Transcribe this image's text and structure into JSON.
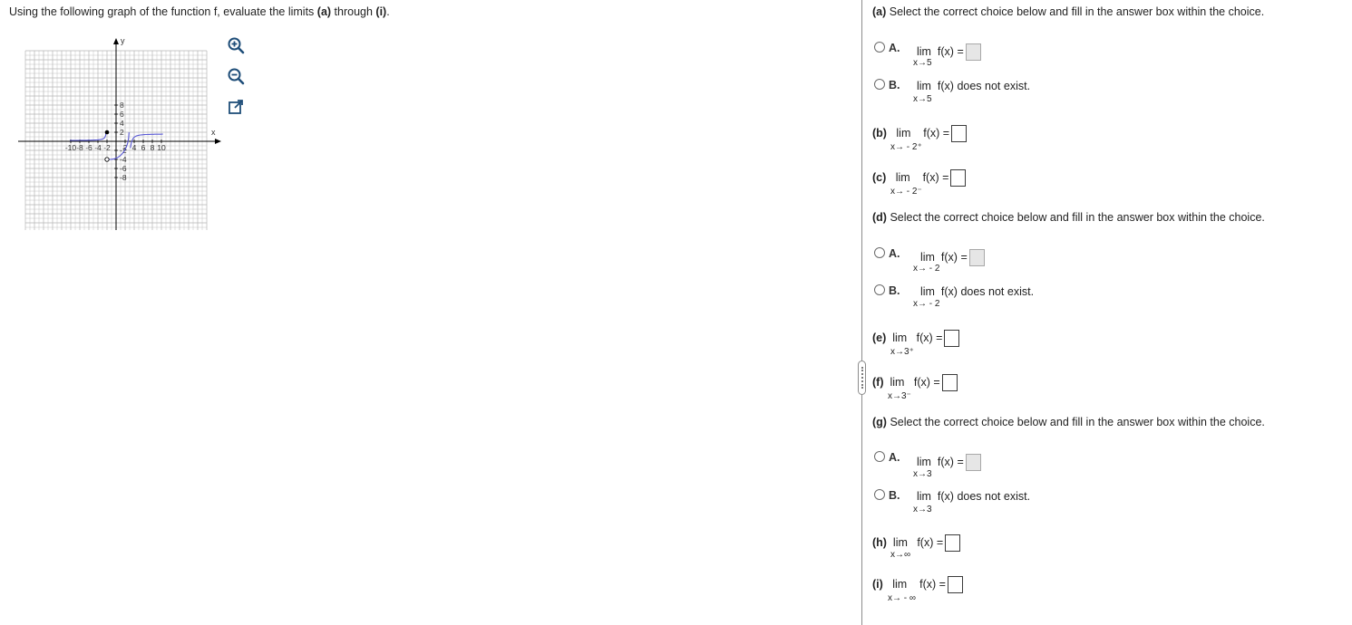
{
  "instructions": {
    "text_before": "Using the following graph of the function f, evaluate the limits ",
    "a": "(a)",
    "mid": " through ",
    "i": "(i)",
    "end": "."
  },
  "graph": {
    "x_label": "x",
    "y_label": "y",
    "x_ticks": [
      "-10",
      "-8",
      "-6",
      "-4",
      "-2",
      "2",
      "4",
      "6",
      "8",
      "10"
    ],
    "y_ticks": [
      "8",
      "6",
      "4",
      "2",
      "-2",
      "-4",
      "-6",
      "-8"
    ],
    "curve_color": "#5b5bd6",
    "grid_color": "#b5b5b5"
  },
  "tools": {
    "zoom_in": "zoom-in-icon",
    "zoom_out": "zoom-out-icon",
    "popout": "popout-icon"
  },
  "questions": {
    "select_prompt": "Select the correct choice below and fill in the answer box within the choice.",
    "a": {
      "label": "(a)",
      "A": "A.",
      "B": "B.",
      "lim": "lim",
      "fx_eq": "f(x) =",
      "dne": "f(x) does not exist.",
      "sub": "x→5"
    },
    "b": {
      "label": "(b)",
      "lim": "lim",
      "fx_eq": "f(x) =",
      "sub": "x→ - 2⁺"
    },
    "c": {
      "label": "(c)",
      "lim": "lim",
      "fx_eq": "f(x) =",
      "sub": "x→ - 2⁻"
    },
    "d": {
      "label": "(d)",
      "A": "A.",
      "B": "B.",
      "lim": "lim",
      "fx_eq": "f(x) =",
      "dne": "f(x) does not exist.",
      "sub": "x→ - 2"
    },
    "e": {
      "label": "(e)",
      "lim": "lim",
      "fx_eq": "f(x) =",
      "sub": "x→3⁺"
    },
    "f": {
      "label": "(f)",
      "lim": "lim",
      "fx_eq": "f(x) =",
      "sub": "x→3⁻"
    },
    "g": {
      "label": "(g)",
      "A": "A.",
      "B": "B.",
      "lim": "lim",
      "fx_eq": "f(x) =",
      "dne": "f(x) does not exist.",
      "sub": "x→3"
    },
    "h": {
      "label": "(h)",
      "lim": "lim",
      "fx_eq": "f(x) =",
      "sub": "x→∞"
    },
    "i": {
      "label": "(i)",
      "lim": "lim",
      "fx_eq": "f(x) =",
      "sub": "x→ - ∞"
    }
  }
}
